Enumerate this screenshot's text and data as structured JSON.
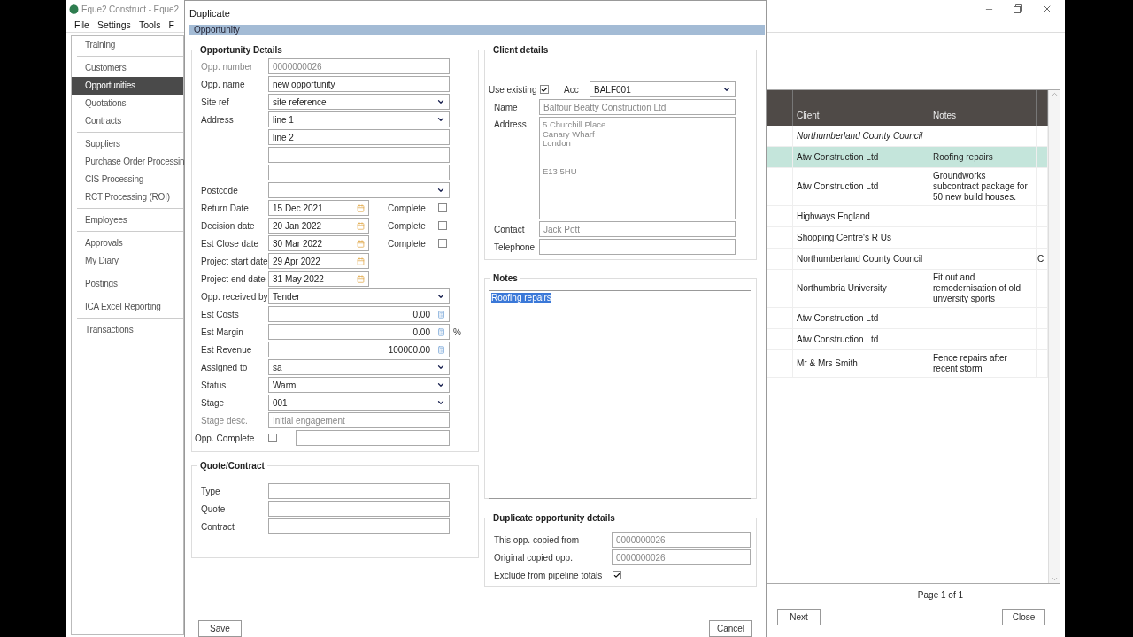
{
  "app": {
    "title": "Eque2 Construct - Eque2",
    "menu": [
      {
        "label": "File"
      },
      {
        "label": "Settings"
      },
      {
        "label": "Tools"
      },
      {
        "label": "F"
      }
    ],
    "sidebar": {
      "groups": [
        {
          "items": [
            {
              "label": "Training",
              "selected": false
            }
          ]
        },
        {
          "items": [
            {
              "label": "Customers",
              "selected": false
            },
            {
              "label": "Opportunities",
              "selected": true
            },
            {
              "label": "Quotations",
              "selected": false
            },
            {
              "label": "Contracts",
              "selected": false
            }
          ]
        },
        {
          "items": [
            {
              "label": "Suppliers",
              "selected": false
            },
            {
              "label": "Purchase Order Processin",
              "selected": false
            },
            {
              "label": "CIS Processing",
              "selected": false
            },
            {
              "label": "RCT Processing (ROI)",
              "selected": false
            }
          ]
        },
        {
          "items": [
            {
              "label": "Employees",
              "selected": false
            }
          ]
        },
        {
          "items": [
            {
              "label": "Approvals",
              "selected": false
            },
            {
              "label": "My Diary",
              "selected": false
            }
          ]
        },
        {
          "items": [
            {
              "label": "Postings",
              "selected": false
            }
          ]
        },
        {
          "items": [
            {
              "label": "ICA Excel Reporting",
              "selected": false
            }
          ]
        },
        {
          "items": [
            {
              "label": "Transactions",
              "selected": false
            }
          ]
        }
      ]
    },
    "table": {
      "columns": [
        {
          "label": "Client"
        },
        {
          "label": "Notes"
        }
      ],
      "rows": [
        {
          "client": "Northumberland County Council",
          "italic": true,
          "selected": false
        },
        {
          "client": "Atw Construction Ltd",
          "notes": "Roofing repairs",
          "italic": false,
          "selected": true
        },
        {
          "client": "Atw Construction Ltd",
          "notes": "Groundworks subcontract package for 50 new build houses.",
          "italic": false,
          "selected": false
        },
        {
          "client": "Highways England",
          "italic": false,
          "selected": false
        },
        {
          "client": "Shopping Centre's R Us",
          "italic": false,
          "selected": false
        },
        {
          "client": "Northumberland County Council",
          "column_4": "C",
          "italic": false,
          "selected": false
        },
        {
          "client": "Northumbria University",
          "notes": "Fit out and remodernisation of old unversity sports",
          "italic": false,
          "selected": false
        },
        {
          "client": "Atw Construction Ltd",
          "italic": false,
          "selected": false
        },
        {
          "client": "Atw Construction Ltd",
          "italic": false,
          "selected": false
        },
        {
          "client": "Mr & Mrs Smith",
          "notes": "Fence repairs after recent storm",
          "italic": false,
          "selected": false
        }
      ]
    },
    "pager": {
      "text": "Page 1 of 1"
    },
    "buttons": [
      {
        "label": "Next"
      },
      {
        "label": "Close"
      }
    ]
  },
  "dialog": {
    "title": "Duplicate",
    "section": "Opportunity",
    "opportunity_details": {
      "legend": "Opportunity Details",
      "fields": [
        {
          "kind": "text",
          "label": "Opp. number",
          "value": "0000000026",
          "readonly": true
        },
        {
          "kind": "text",
          "label": "Opp. name",
          "value": "new opportunity",
          "readonly": false
        },
        {
          "kind": "select",
          "label": "Site ref",
          "value": "site reference"
        },
        {
          "kind": "select",
          "label": "Address",
          "value": "line 1"
        },
        {
          "kind": "text",
          "value": "line 2",
          "readonly": false
        },
        {
          "kind": "text"
        },
        {
          "kind": "text"
        },
        {
          "kind": "select",
          "label": "Postcode"
        },
        {
          "kind": "date",
          "label": "Return Date",
          "value": "15 Dec 2021",
          "complete": {
            "label": "Complete",
            "checked": false
          }
        },
        {
          "kind": "date",
          "label": "Decision date",
          "value": "20 Jan 2022",
          "complete": {
            "label": "Complete",
            "checked": false
          }
        },
        {
          "kind": "date",
          "label": "Est Close date",
          "value": "30 Mar 2022",
          "complete": {
            "label": "Complete",
            "checked": false
          }
        },
        {
          "kind": "date",
          "label": "Project start date",
          "value": "29 Apr 2022"
        },
        {
          "kind": "date",
          "label": "Project end date",
          "value": "31 May 2022"
        },
        {
          "kind": "select",
          "label": "Opp. received by",
          "value": "Tender"
        },
        {
          "kind": "number",
          "label": "Est Costs",
          "value": "0.00"
        },
        {
          "kind": "number",
          "label": "Est Margin",
          "value": "0.00",
          "suffix": "%"
        },
        {
          "kind": "number",
          "label": "Est Revenue",
          "value": "100000.00"
        },
        {
          "kind": "select",
          "label": "Assigned to",
          "value": "sa"
        },
        {
          "kind": "select",
          "label": "Status",
          "value": "Warm"
        },
        {
          "kind": "select",
          "label": "Stage",
          "value": "001"
        },
        {
          "kind": "text",
          "label": "Stage desc.",
          "value": "Initial engagement",
          "readonly": true
        },
        {
          "kind": "check_text",
          "label": "Opp. Complete",
          "checked": false
        }
      ]
    },
    "quote_contract": {
      "legend": "Quote/Contract",
      "fields": [
        {
          "label": "Type"
        },
        {
          "label": "Quote"
        },
        {
          "label": "Contract"
        }
      ]
    },
    "client_details": {
      "legend": "Client details",
      "use_existing": {
        "label": "Use existing",
        "checked": true
      },
      "acc": {
        "label": "Acc",
        "value": "BALF001"
      },
      "fields": [
        {
          "kind": "text",
          "label": "Name",
          "value": "Balfour Beatty Construction Ltd",
          "readonly": true
        },
        {
          "kind": "multiline",
          "label": "Address",
          "paragraphs": [
            [
              "5 Churchill Place",
              "Canary Wharf",
              "London"
            ],
            [
              "E13 5HU"
            ]
          ]
        },
        {
          "kind": "text",
          "label": "Contact",
          "value": "Jack Pott",
          "readonly": true
        },
        {
          "kind": "text",
          "label": "Telephone"
        }
      ]
    },
    "notes": {
      "legend": "Notes",
      "text": "Roofing repairs",
      "text_selected": true
    },
    "duplicate_details": {
      "legend": "Duplicate opportunity details",
      "fields": [
        {
          "label": "This opp. copied from",
          "value": "0000000026"
        },
        {
          "label": "Original copied opp.",
          "value": "0000000026"
        }
      ],
      "exclude": {
        "label": "Exclude from pipeline totals",
        "checked": true
      }
    },
    "buttons": [
      {
        "label": "Save"
      },
      {
        "label": "Cancel"
      }
    ]
  }
}
